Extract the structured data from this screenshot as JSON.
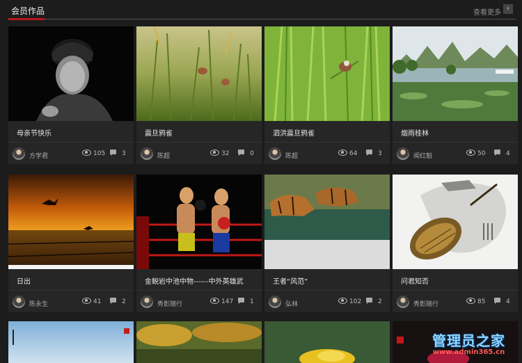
{
  "header": {
    "title": "会员作品",
    "more_label": "查看更多",
    "more_icon": "chevron-right-icon"
  },
  "cards": [
    {
      "caption": "母亲节快乐",
      "author": "方学君",
      "views": "105",
      "comments": "3"
    },
    {
      "caption": "震旦鸦雀",
      "author": "陈超",
      "views": "32",
      "comments": "0"
    },
    {
      "caption": "泗洪震旦鸦雀",
      "author": "陈超",
      "views": "64",
      "comments": "3"
    },
    {
      "caption": "烟雨桂林",
      "author": "闻红魁",
      "views": "50",
      "comments": "4"
    },
    {
      "caption": "日出",
      "author": "陈永生",
      "views": "41",
      "comments": "2"
    },
    {
      "caption": "金鲵岩中池中物------中外英雄武",
      "author": "秀影随行",
      "views": "147",
      "comments": "1"
    },
    {
      "caption": "王者“风范”",
      "author": "弘林",
      "views": "102",
      "comments": "2"
    },
    {
      "caption": "问君知否",
      "author": "秀影随行",
      "views": "85",
      "comments": "4"
    }
  ],
  "watermark": {
    "line1": "管理员之家",
    "line2": "www.admin365.cn"
  },
  "colors": {
    "accent": "#b8171b",
    "background": "#1c1c1c",
    "card": "#262626"
  }
}
